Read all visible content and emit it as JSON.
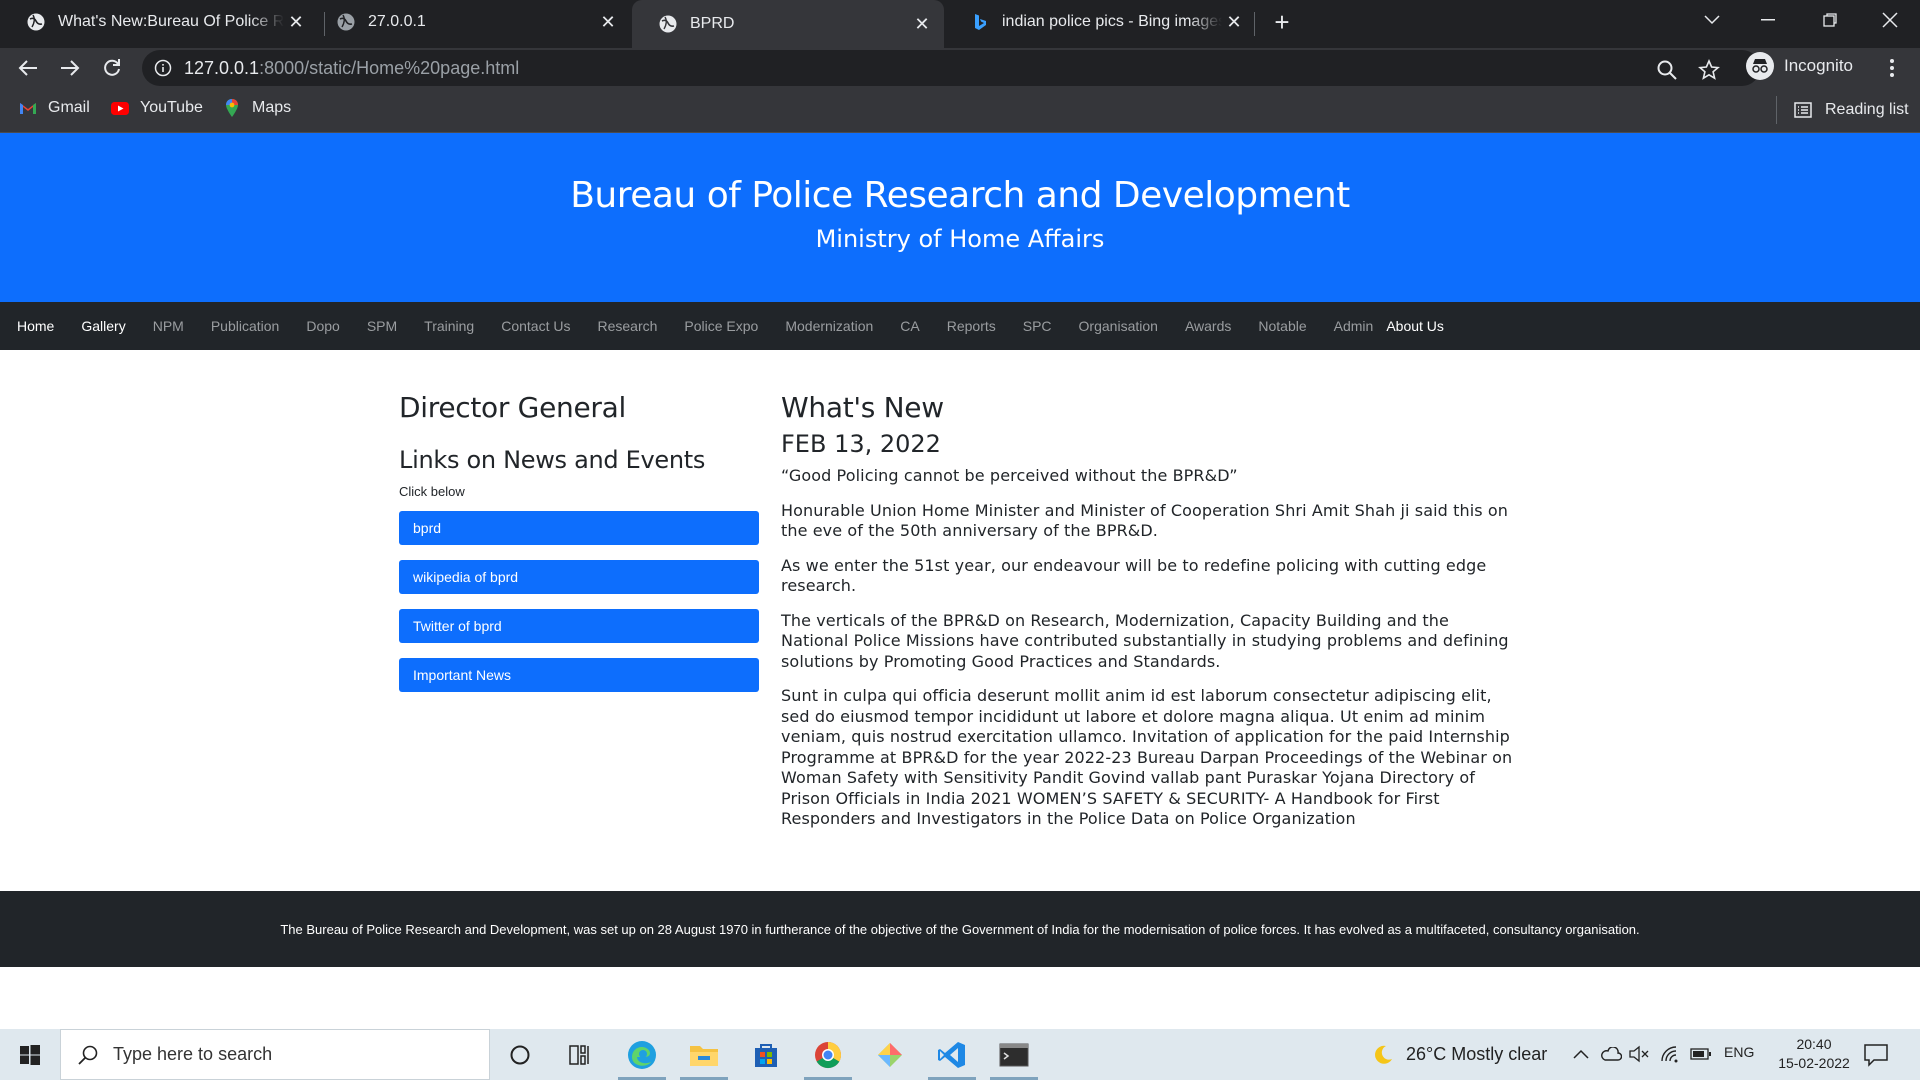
{
  "browser": {
    "tabs": [
      {
        "title": "What's New:Bureau Of Police Research and Development",
        "active": false
      },
      {
        "title": "27.0.0.1",
        "active": false
      },
      {
        "title": "BPRD",
        "active": true
      },
      {
        "title": "indian police pics - Bing images",
        "active": false
      }
    ],
    "url_host": "127.0.0.1",
    "url_rest": ":8000/static/Home%20page.html",
    "profile_label": "Incognito",
    "bookmarks": [
      "Gmail",
      "YouTube",
      "Maps"
    ],
    "reading_list": "Reading list"
  },
  "site": {
    "title": "Bureau of Police Research and Development",
    "subtitle": "Ministry of Home Affairs",
    "nav": [
      "Home",
      "Gallery",
      "NPM",
      "Publication",
      "Dopo",
      "SPM",
      "Training",
      "Contact Us",
      "Research",
      "Police Expo",
      "Modernization",
      "CA",
      "Reports",
      "SPC",
      "Organisation",
      "Awards",
      "Notable",
      "Admin",
      "About Us"
    ],
    "nav_active": [
      "Home",
      "Gallery",
      "About Us"
    ],
    "left": {
      "heading_dg": "Director General",
      "heading_links": "Links on News and Events",
      "click_below": "Click below",
      "buttons": [
        "bprd",
        "wikipedia of bprd",
        "Twitter of bprd",
        "Important News"
      ]
    },
    "right": {
      "heading": "What's New",
      "date": "FEB 13, 2022",
      "quote": "“Good Policing cannot be perceived without the BPR&D”",
      "paragraphs": [
        "Honurable Union Home Minister and Minister of Cooperation Shri Amit Shah ji said this on the eve of the 50th anniversary of the BPR&D.",
        "As we enter the 51st year, our endeavour will be to redefine policing with cutting edge research.",
        "The verticals of the BPR&D on Research, Modernization, Capacity Building and the National Police Missions have contributed substantially in studying problems and defining solutions by Promoting Good Practices and Standards.",
        "Sunt in culpa qui officia deserunt mollit anim id est laborum consectetur adipiscing elit, sed do eiusmod tempor incididunt ut labore et dolore magna aliqua. Ut enim ad minim veniam, quis nostrud exercitation ullamco. Invitation of application for the paid Internship Programme at BPR&D for the year 2022-23 Bureau Darpan Proceedings of the Webinar on Woman Safety with Sensitivity Pandit Govind vallab pant Puraskar Yojana Directory of Prison Officials in India 2021 WOMEN’S SAFETY & SECURITY- A Handbook for First Responders and Investigators in the Police Data on Police Organization"
      ]
    },
    "footer": "The Bureau of Police Research and Development, was set up on 28 August 1970 in furtherance of the objective of the Government of India for the modernisation of police forces. It has evolved as a multifaceted, consultancy organisation."
  },
  "taskbar": {
    "search_placeholder": "Type here to search",
    "weather": "26°C  Mostly clear",
    "lang": "ENG",
    "time": "20:40",
    "date": "15-02-2022"
  },
  "colors": {
    "brand_blue": "#0d6efd",
    "nav_dark": "#212529"
  }
}
